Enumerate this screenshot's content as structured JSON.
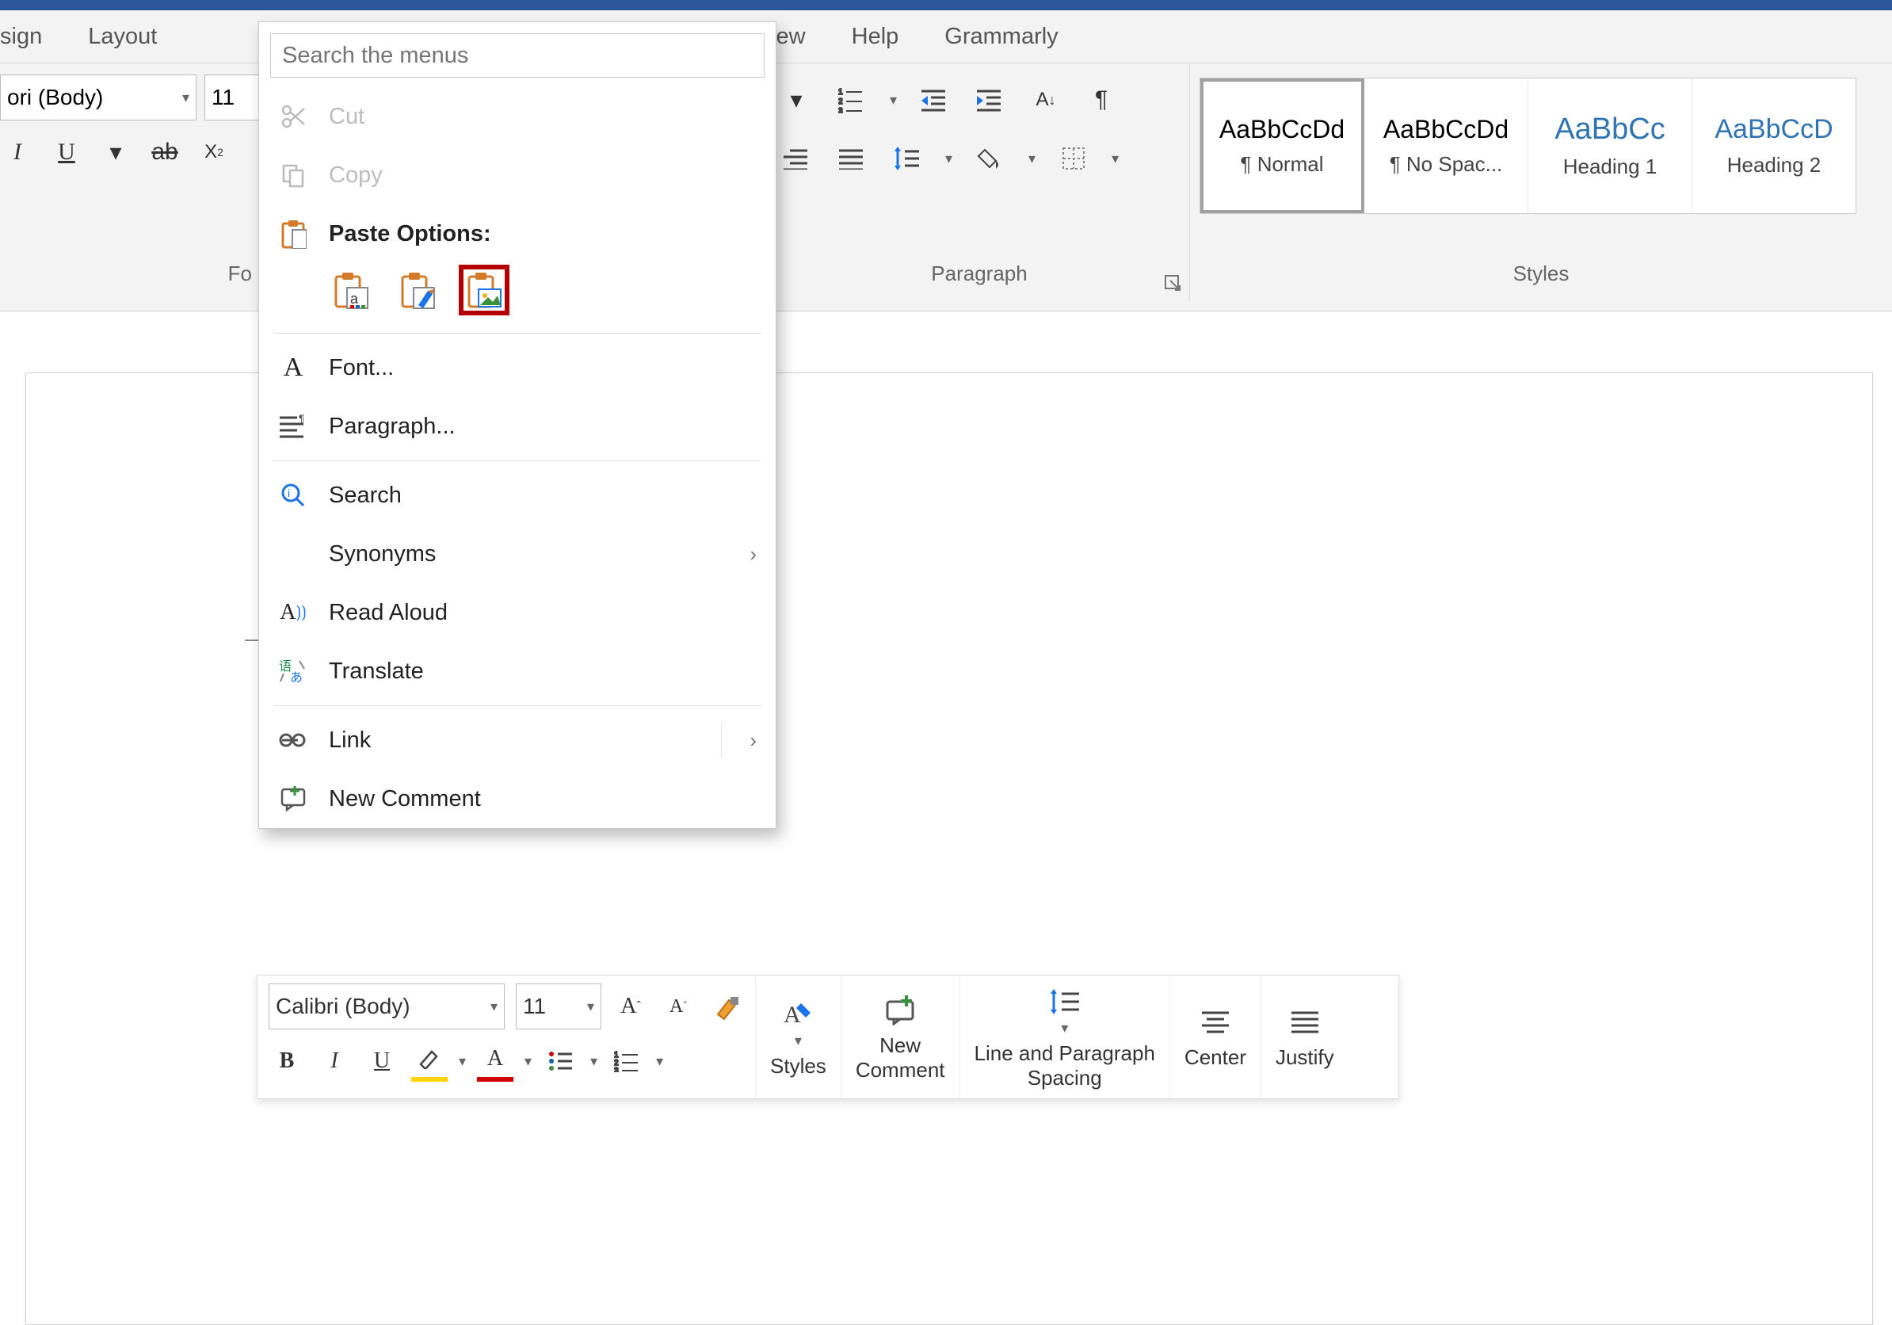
{
  "ribbon": {
    "tabs": [
      "sign",
      "Layout",
      "View",
      "Help",
      "Grammarly"
    ],
    "font_group_label": "Fo",
    "para_group_label": "Paragraph",
    "styles_group_label": "Styles",
    "font": {
      "name": "ori (Body)",
      "size": "11"
    },
    "styles": [
      {
        "preview": "AaBbCcDd",
        "name": "¶ Normal",
        "accent": false
      },
      {
        "preview": "AaBbCcDd",
        "name": "¶ No Spac...",
        "accent": false
      },
      {
        "preview": "AaBbCc",
        "name": "Heading 1",
        "accent": true
      },
      {
        "preview": "AaBbCcD",
        "name": "Heading 2",
        "accent": true
      }
    ]
  },
  "context_menu": {
    "search_placeholder": "Search the menus",
    "cut": "Cut",
    "copy": "Copy",
    "paste_options": "Paste Options:",
    "font": "Font...",
    "paragraph": "Paragraph...",
    "search": "Search",
    "synonyms": "Synonyms",
    "read_aloud": "Read Aloud",
    "translate": "Translate",
    "link": "Link",
    "new_comment": "New Comment"
  },
  "mini_toolbar": {
    "font_name": "Calibri (Body)",
    "font_size": "11",
    "styles": "Styles",
    "new_comment_top": "New",
    "new_comment_bottom": "Comment",
    "line_spacing_top": "Line and Paragraph",
    "line_spacing_bottom": "Spacing",
    "center": "Center",
    "justify": "Justify"
  }
}
